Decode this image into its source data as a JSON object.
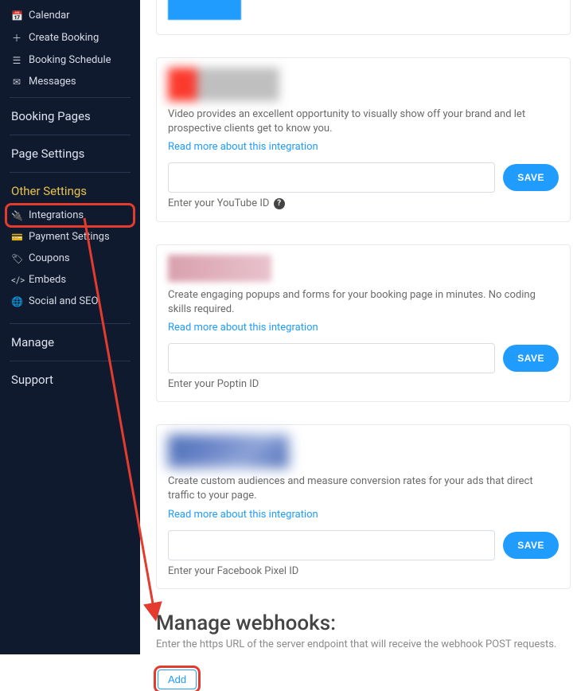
{
  "sidebar": {
    "items_top": [
      {
        "icon": "📅",
        "label": "Calendar"
      },
      {
        "icon": "＋",
        "label": "Create Booking"
      },
      {
        "icon": "☰",
        "label": "Booking Schedule"
      },
      {
        "icon": "✉",
        "label": "Messages"
      }
    ],
    "booking_pages": "Booking Pages",
    "page_settings": "Page Settings",
    "other_settings": "Other Settings",
    "items_other": [
      {
        "icon": "🔌",
        "label": "Integrations",
        "highlight": true
      },
      {
        "icon": "💳",
        "label": "Payment Settings"
      },
      {
        "icon": "🏷",
        "label": "Coupons"
      },
      {
        "icon": "</>",
        "label": "Embeds"
      },
      {
        "icon": "🌐",
        "label": "Social and SEO"
      }
    ],
    "manage": "Manage",
    "support": "Support"
  },
  "integrations": [
    {
      "id": "youtube",
      "desc": "Video provides an excellent opportunity to visually show off your brand and let prospective clients get to know you.",
      "read_more": "Read more about this integration",
      "save": "SAVE",
      "hint": "Enter your YouTube ID",
      "help": true
    },
    {
      "id": "poptin",
      "desc": "Create engaging popups and forms for your booking page in minutes. No coding skills required.",
      "read_more": "Read more about this integration",
      "save": "SAVE",
      "hint": "Enter your Poptin ID",
      "help": false
    },
    {
      "id": "facebook",
      "desc": "Create custom audiences and measure conversion rates for your ads that direct traffic to your page.",
      "read_more": "Read more about this integration",
      "save": "SAVE",
      "hint": "Enter your Facebook Pixel ID",
      "help": false
    }
  ],
  "top_partial": {
    "save": ""
  },
  "webhooks": {
    "title": "Manage webhooks:",
    "desc": "Enter the https URL of the server endpoint that will receive the webhook POST requests.",
    "add": "Add"
  }
}
